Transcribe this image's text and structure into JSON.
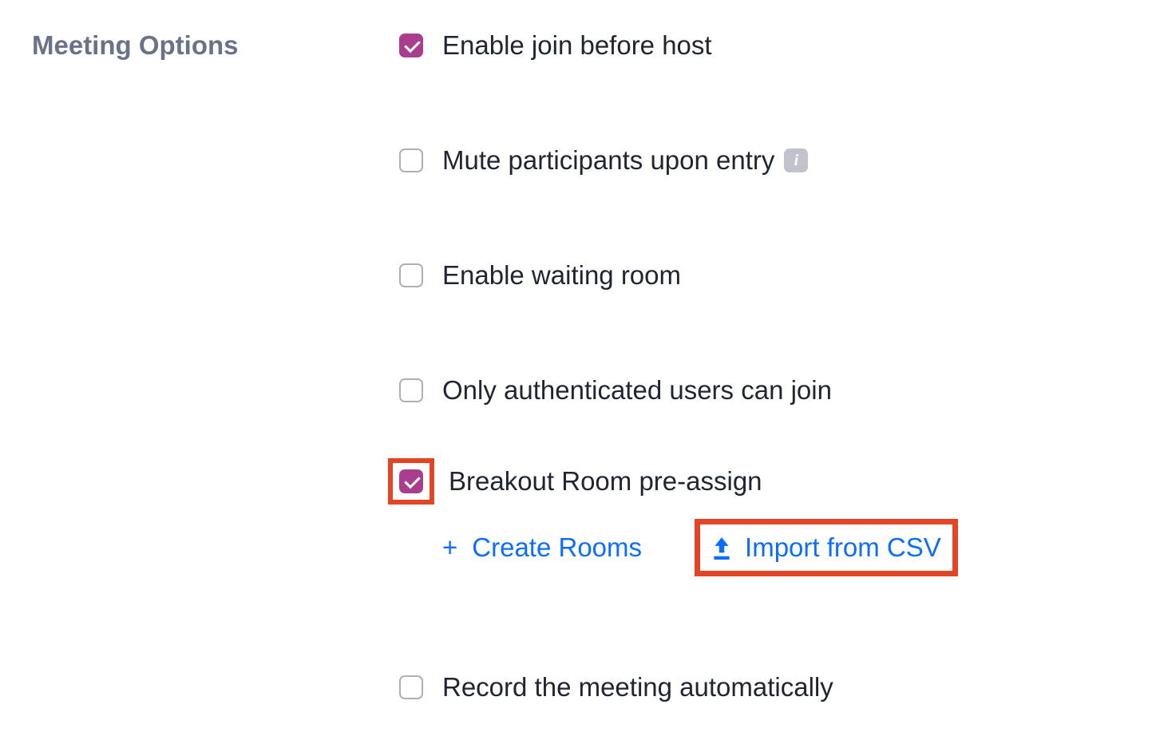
{
  "section_title": "Meeting Options",
  "options": {
    "enable_join_before_host": {
      "label": "Enable join before host",
      "checked": true
    },
    "mute_participants": {
      "label": "Mute participants upon entry",
      "checked": false
    },
    "enable_waiting_room": {
      "label": "Enable waiting room",
      "checked": false
    },
    "only_authenticated": {
      "label": "Only authenticated users can join",
      "checked": false
    },
    "breakout_preassign": {
      "label": "Breakout Room pre-assign",
      "checked": true
    },
    "record_automatically": {
      "label": "Record the meeting automatically",
      "checked": false
    }
  },
  "sub_actions": {
    "create_rooms": "Create Rooms",
    "import_csv": "Import from CSV"
  },
  "colors": {
    "accent": "#a93e8e",
    "link": "#0d6efd",
    "highlight": "#e34424",
    "title": "#6b7189"
  }
}
